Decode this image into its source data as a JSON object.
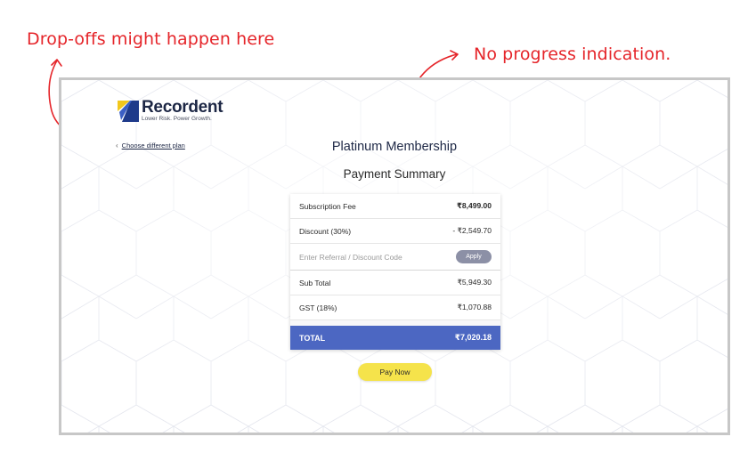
{
  "annotations": {
    "dropoff_note": "Drop-offs might happen here",
    "progress_note": "No progress indication.",
    "color": "#e5252a"
  },
  "brand": {
    "name": "Recordent",
    "tagline": "Lower Risk. Power Growth."
  },
  "nav": {
    "back_label": "Choose different plan",
    "back_icon": "chevron-left-icon"
  },
  "plan": {
    "title": "Platinum Membership",
    "summary_title": "Payment Summary"
  },
  "summary": {
    "subscription_label": "Subscription Fee",
    "subscription_value": "₹8,499.00",
    "discount_label": "Discount (30%)",
    "discount_value": "- ₹2,549.70",
    "code_placeholder": "Enter Referral / Discount Code",
    "apply_label": "Apply",
    "subtotal_label": "Sub Total",
    "subtotal_value": "₹5,949.30",
    "gst_label": "GST (18%)",
    "gst_value": "₹1,070.88",
    "total_label": "TOTAL",
    "total_value": "₹7,020.18"
  },
  "actions": {
    "pay_label": "Pay Now"
  },
  "colors": {
    "primary_navy": "#1d2745",
    "total_bar": "#4c67c2",
    "pay_button": "#f5e34b",
    "apply_button": "#8c90a6",
    "frame_border": "#c7c7c7"
  }
}
